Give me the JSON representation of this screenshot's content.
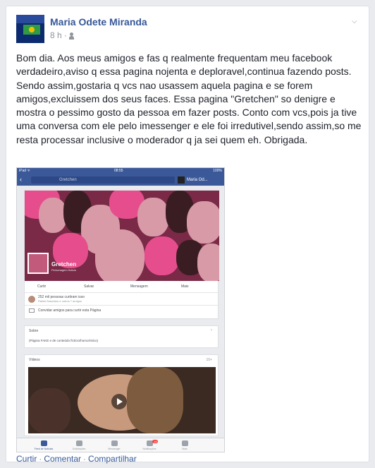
{
  "post": {
    "author": "Maria Odete Miranda",
    "time": "8 h",
    "separator": "·",
    "audience_icon": "friends-icon",
    "menu_icon": "chevron-down-icon",
    "text": "Bom dia. Aos meus amigos e fas q realmente frequentam meu facebook verdadeiro,aviso q essa pagina nojenta e deploravel,continua fazendo posts. Sendo assim,gostaria q vcs nao usassem aquela pagina e se forem amigos,excluissem dos seus faces. Essa pagina \"Gretchen\" so denigre e mostra o pessimo gosto da pessoa em fazer posts. Conto com vcs,pois ja tive uma conversa com ele pelo imessenger e ele foi irredutivel,sendo assim,so me resta processar inclusive o moderador q ja sei quem eh. Obrigada."
  },
  "screenshot": {
    "status_left": "iPad ᯤ",
    "status_time": "08:55",
    "status_right": "100%",
    "search_text": "Gretchen",
    "me_label": "Maria Od...",
    "page_name": "Gretchen",
    "page_category": "Personagem fictício",
    "actions": [
      "Curtir",
      "Salvar",
      "Mensagem",
      "Mais"
    ],
    "likes_line1": "252 mil pessoas curtiram isso",
    "likes_line2": "Rafael Nascidos e outros 7 amigos",
    "invite": "Convidar amigos para curtir esta Página",
    "about_title": "Sobre",
    "about_body": "(Página FAKE e de conteúdo fictício/humorístico)",
    "videos_title": "Vídeos",
    "videos_count": "10+",
    "tabs": [
      "Feed de Notícias",
      "Solicitações",
      "Messenger",
      "Notificações",
      "Mais"
    ],
    "notif_badge": "18"
  },
  "footer": {
    "like": "Curtir",
    "comment": "Comentar",
    "share": "Compartilhar",
    "dot": "·"
  },
  "colors": {
    "facebook_blue": "#3b5998",
    "link": "#365899"
  }
}
